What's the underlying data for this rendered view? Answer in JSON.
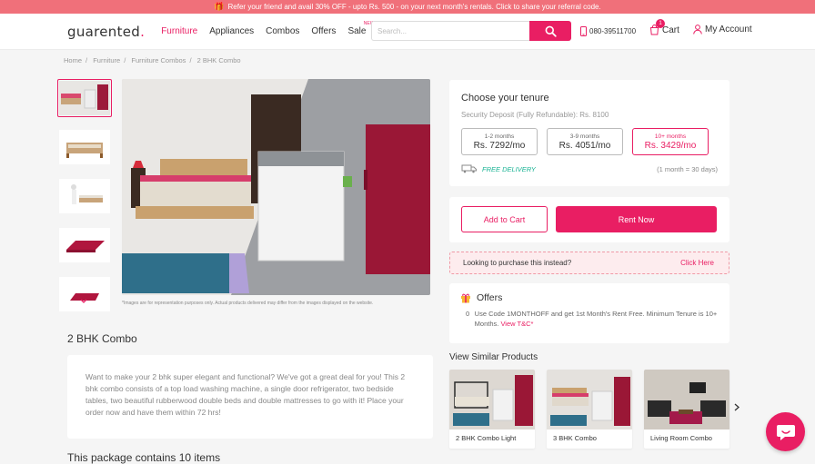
{
  "promo": {
    "text": "Refer your friend and avail 30% OFF - upto Rs. 500 - on your next month's rentals. Click to share your referral code.",
    "icon": "gift-icon"
  },
  "header": {
    "logo": "guarented",
    "nav": [
      "Furniture",
      "Appliances",
      "Combos",
      "Offers",
      "Sale"
    ],
    "sale_badge": "NEW",
    "search_placeholder": "Search...",
    "phone": "080-39511700",
    "cart_label": "Cart",
    "cart_count": "1",
    "account_label": "My Account"
  },
  "breadcrumb": [
    "Home",
    "Furniture",
    "Furniture Combos",
    "2 BHK Combo"
  ],
  "disclaimer": "*Images are for representation purposes only. Actual products delivered may differ from the images displayed on the website.",
  "tenure": {
    "title": "Choose your tenure",
    "deposit": "Security Deposit (Fully Refundable): Rs. 8100",
    "options": [
      {
        "months": "1-2 months",
        "price": "Rs. 7292/mo"
      },
      {
        "months": "3-9 months",
        "price": "Rs. 4051/mo"
      },
      {
        "months": "10+ months",
        "price": "Rs. 3429/mo"
      }
    ],
    "delivery": "FREE DELIVERY",
    "month_note": "(1 month = 30 days)"
  },
  "actions": {
    "add_to_cart": "Add to Cart",
    "rent_now": "Rent Now"
  },
  "purchase": {
    "text": "Looking to purchase this instead?",
    "link": "Click Here"
  },
  "offers": {
    "title": "Offers",
    "items": [
      {
        "num": "0",
        "text": "Use Code 1MONTHOFF and get 1st Month's Rent Free. Minimum Tenure is 10+ Months.",
        "link": "View T&C*"
      }
    ]
  },
  "product": {
    "title": "2 BHK Combo",
    "description": "Want to make your 2 bhk super elegant and functional? We've got a great deal for you! This 2 bhk combo consists of a top load washing machine, a single door refrigerator, two bedside tables, two beautiful rubberwood double beds and double mattresses to go with it! Place your order now and have them within 72 hrs!",
    "package": "This package contains 10 items"
  },
  "similar": {
    "title": "View Similar Products",
    "items": [
      "2 BHK Combo Light",
      "3 BHK Combo",
      "Living Room Combo"
    ]
  },
  "colors": {
    "accent": "#e91e63",
    "promo_bar": "#f0707a",
    "delivery": "#1ab394"
  }
}
